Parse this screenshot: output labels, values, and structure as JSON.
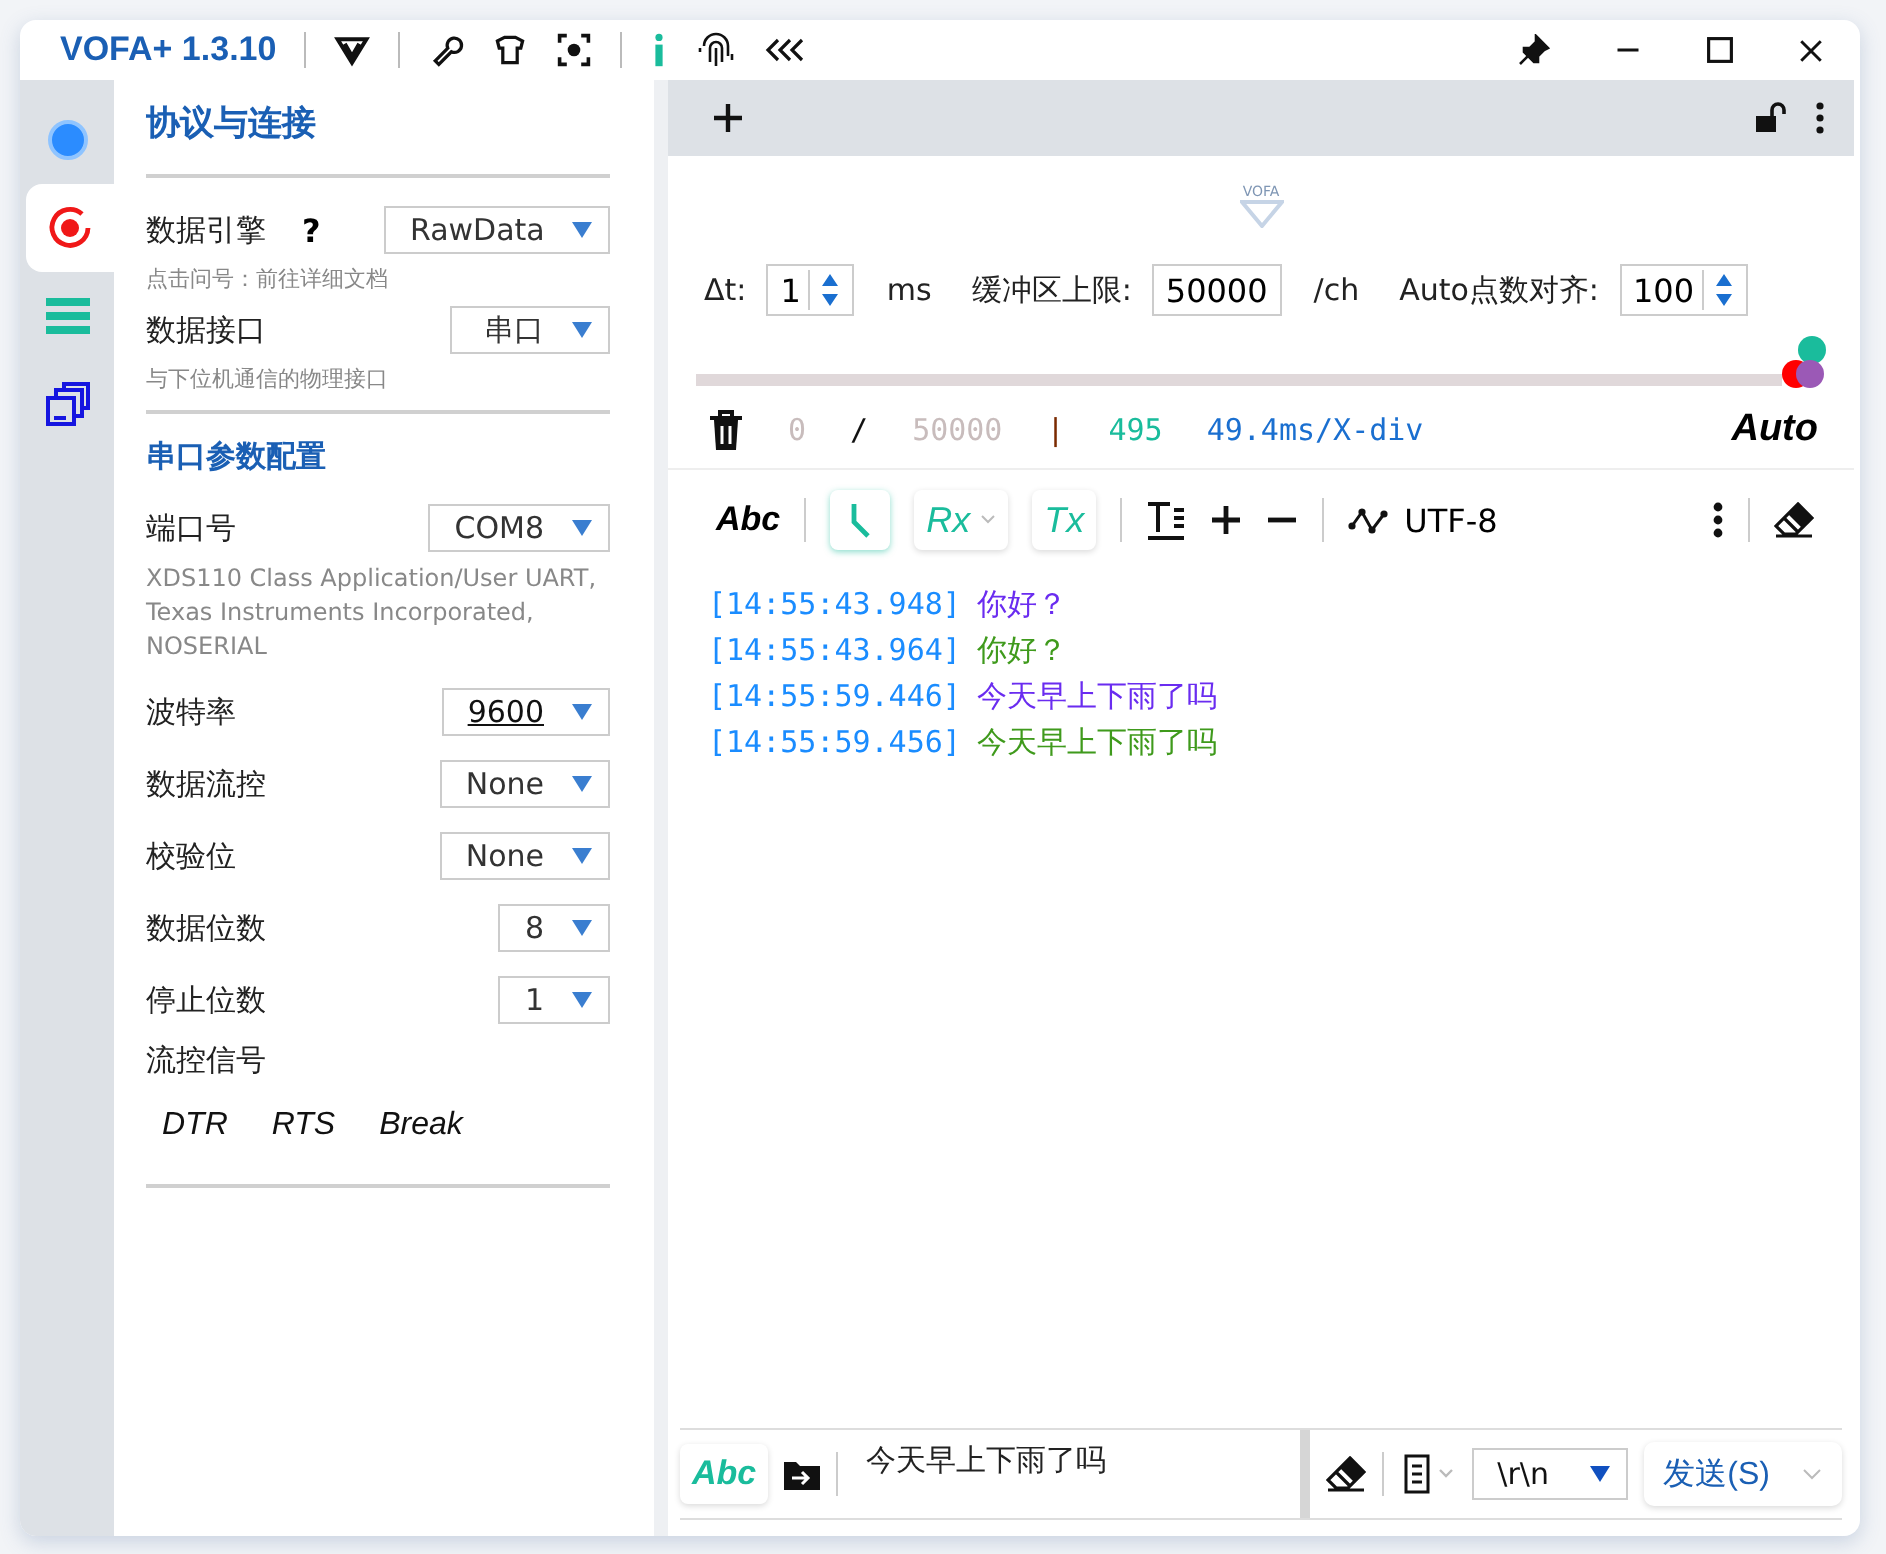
{
  "window": {
    "title": "VOFA+ 1.3.10"
  },
  "rail": [
    {
      "kind": "dot",
      "selected": false
    },
    {
      "kind": "target",
      "selected": true
    },
    {
      "kind": "list",
      "selected": false
    },
    {
      "kind": "windows",
      "selected": false
    }
  ],
  "left_panel": {
    "title": "协议与连接",
    "engine": {
      "label": "数据引擎",
      "help": "?",
      "value": "RawData",
      "hint": "点击问号：前往详细文档"
    },
    "interface": {
      "label": "数据接口",
      "value": "串口",
      "hint": "与下位机通信的物理接口"
    },
    "section": "串口参数配置",
    "params": [
      {
        "label": "端口号",
        "value": "COM8",
        "hint": "XDS110 Class Application/User UART, Texas Instruments Incorporated, NOSERIAL",
        "editable": false
      },
      {
        "label": "波特率",
        "value": "9600",
        "editable": true
      },
      {
        "label": "数据流控",
        "value": "None",
        "editable": false
      },
      {
        "label": "校验位",
        "value": "None",
        "editable": false
      },
      {
        "label": "数据位数",
        "value": "8",
        "editable": false
      },
      {
        "label": "停止位数",
        "value": "1",
        "editable": false
      }
    ],
    "signals": {
      "label": "流控信号",
      "buttons": [
        "DTR",
        "RTS",
        "Break"
      ]
    }
  },
  "main": {
    "logo": "VOFA",
    "settings": [
      {
        "label": "Δt:",
        "value": "1",
        "unit": "ms",
        "spinner": true
      },
      {
        "label": "缓冲区上限:",
        "value": "50000",
        "unit": "/ch",
        "spinner": false
      },
      {
        "label": "Auto点数对齐:",
        "value": "100",
        "spinner": true
      }
    ],
    "channel_dots": [
      {
        "color": "#1abc9c"
      },
      {
        "color": "#ff0000"
      },
      {
        "color": "#9b59b6"
      }
    ],
    "stats": {
      "count": "0",
      "slash": "/",
      "total": "50000",
      "bar": "|",
      "points": "495",
      "scale": "49.4ms/X-div",
      "mode": "Auto"
    },
    "toolbar": {
      "abc": "Abc",
      "timestamp_on": true,
      "rx": "Rx",
      "tx": "Tx",
      "encoding": "UTF-8"
    },
    "log": [
      {
        "time": "[14:55:43.948]",
        "text": "你好？",
        "color": "#6a2cf0"
      },
      {
        "time": "[14:55:43.964]",
        "text": "你好？",
        "color": "#3f9a1c"
      },
      {
        "time": "[14:55:59.446]",
        "text": "今天早上下雨了吗",
        "color": "#6a2cf0"
      },
      {
        "time": "[14:55:59.456]",
        "text": "今天早上下雨了吗",
        "color": "#3f9a1c"
      }
    ],
    "send_bar": {
      "abc": "Abc",
      "input": "今天早上下雨了吗",
      "line_end": "\\r\\n",
      "send": "发送(S)"
    }
  }
}
